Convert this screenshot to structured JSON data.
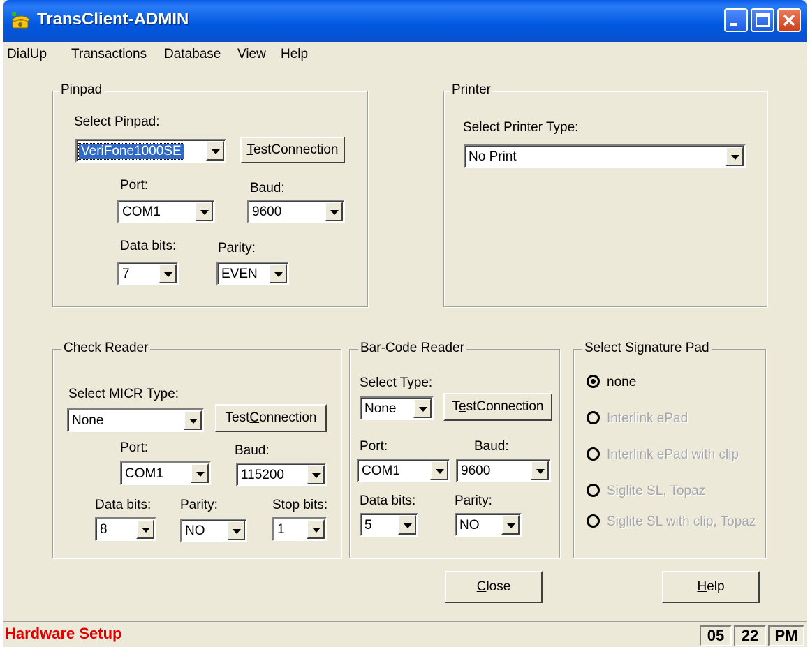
{
  "window": {
    "title": "TransClient-ADMIN"
  },
  "menu": [
    "DialUp",
    "Transactions",
    "Database",
    "View",
    "Help"
  ],
  "pinpad": {
    "legend": "Pinpad",
    "select_label": "Select Pinpad:",
    "select_value": "VeriFone1000SE",
    "test_button": "TestConnection",
    "port_label": "Port:",
    "port_value": "COM1",
    "baud_label": "Baud:",
    "baud_value": "9600",
    "databits_label": "Data bits:",
    "databits_value": "7",
    "parity_label": "Parity:",
    "parity_value": "EVEN"
  },
  "printer": {
    "legend": "Printer",
    "select_label": "Select Printer Type:",
    "select_value": "No Print"
  },
  "check_reader": {
    "legend": "Check Reader",
    "select_label": "Select MICR Type:",
    "select_value": "None",
    "test_button": "TestConnection",
    "port_label": "Port:",
    "port_value": "COM1",
    "baud_label": "Baud:",
    "baud_value": "115200",
    "databits_label": "Data bits:",
    "databits_value": "8",
    "parity_label": "Parity:",
    "parity_value": "NO",
    "stopbits_label": "Stop bits:",
    "stopbits_value": "1"
  },
  "barcode_reader": {
    "legend": "Bar-Code Reader",
    "select_label": "Select Type:",
    "select_value": "None",
    "test_button": "TestConnection",
    "port_label": "Port:",
    "port_value": "COM1",
    "baud_label": "Baud:",
    "baud_value": "9600",
    "databits_label": "Data bits:",
    "databits_value": "5",
    "parity_label": "Parity:",
    "parity_value": "NO"
  },
  "signature_pad": {
    "legend": "Select Signature Pad",
    "options": [
      {
        "label": "none",
        "selected": true,
        "enabled": true
      },
      {
        "label": "Interlink ePad",
        "selected": false,
        "enabled": false
      },
      {
        "label": "Interlink ePad with clip",
        "selected": false,
        "enabled": false
      },
      {
        "label": "Siglite SL, Topaz",
        "selected": false,
        "enabled": false
      },
      {
        "label": "Siglite SL with clip, Topaz",
        "selected": false,
        "enabled": false
      }
    ]
  },
  "buttons": {
    "close": "Close",
    "help": "Help"
  },
  "status": {
    "title": "Hardware Setup",
    "hour": "05",
    "minute": "22",
    "ampm": "PM"
  },
  "colors": {
    "titlebar": "#0058E0",
    "status_text": "#E00000",
    "face": "#ECE9D8",
    "selection": "#316AC5"
  }
}
